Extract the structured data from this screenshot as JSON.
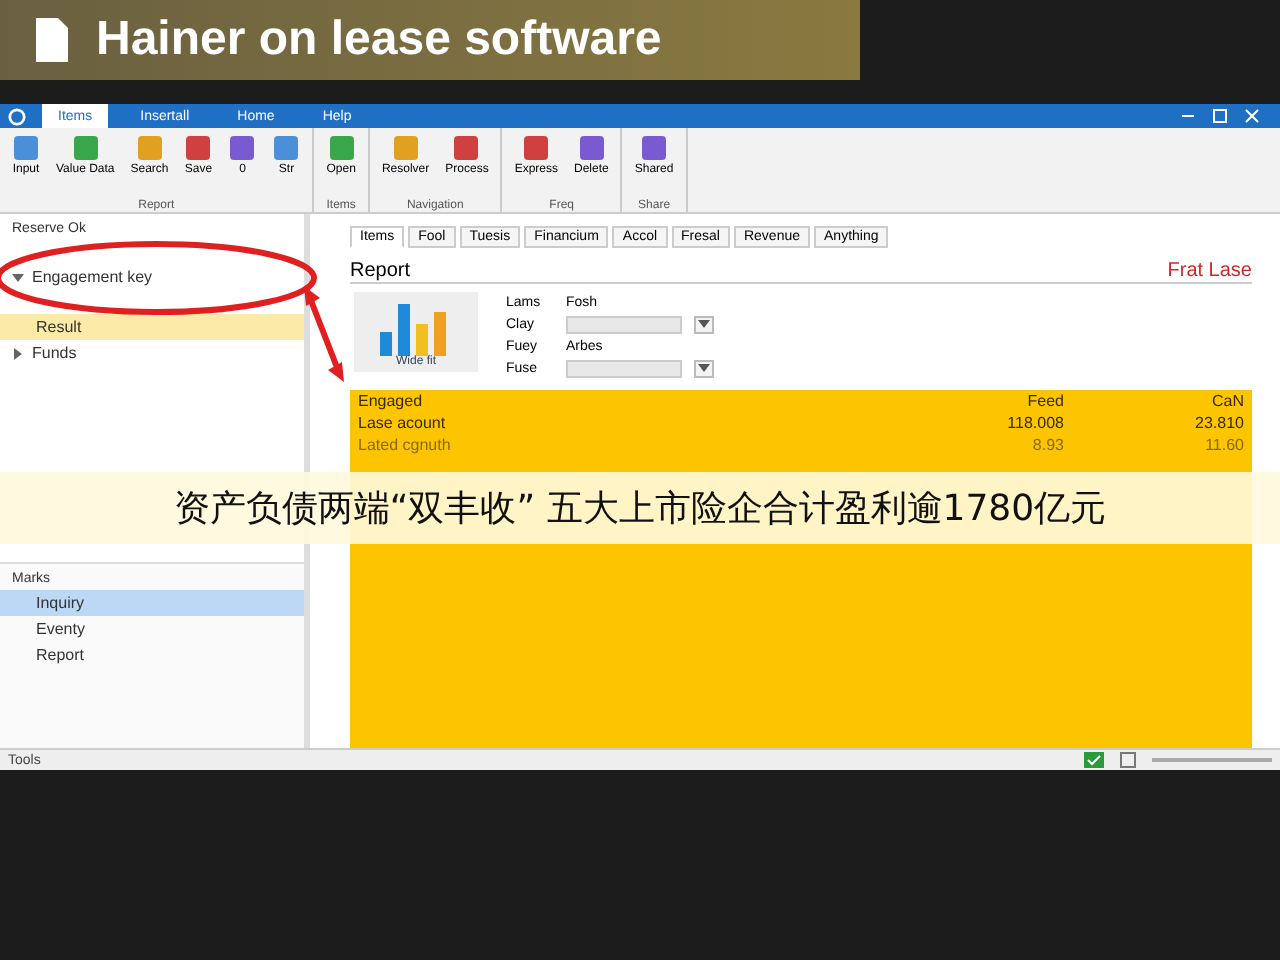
{
  "banner": {
    "title": "Hainer on lease software"
  },
  "window": {
    "tabs": [
      {
        "label": "Items",
        "selected": true
      },
      {
        "label": "Insertall",
        "selected": false
      },
      {
        "label": "Home",
        "selected": false
      },
      {
        "label": "Help",
        "selected": false
      }
    ]
  },
  "ribbon": {
    "groups": [
      {
        "label": "Report",
        "buttons": [
          "Input",
          "Value Data",
          "Search",
          "Save",
          "0",
          "Str"
        ]
      },
      {
        "label": "Items",
        "buttons": [
          "Open"
        ]
      },
      {
        "label": "Navigation",
        "buttons": [
          "Resolver",
          "Process"
        ]
      },
      {
        "label": "Freq",
        "buttons": [
          "Express",
          "Delete"
        ]
      },
      {
        "label": "Share",
        "buttons": [
          "Shared"
        ]
      }
    ]
  },
  "sidebar": {
    "header": "Reserve Ok",
    "tree": [
      {
        "label": "Engagement key",
        "expanded": true,
        "selected": false,
        "children": [
          {
            "label": "Result",
            "selected": true
          }
        ]
      },
      {
        "label": "Funds",
        "expanded": false,
        "selected": false
      }
    ],
    "lower_header": "Marks",
    "items": [
      {
        "label": "Inquiry",
        "selected": true
      },
      {
        "label": "Eventy",
        "selected": false
      },
      {
        "label": "Report",
        "selected": false
      }
    ]
  },
  "content": {
    "tabs": [
      {
        "label": "Items",
        "selected": true
      },
      {
        "label": "Fool",
        "selected": false
      },
      {
        "label": "Tuesis",
        "selected": false
      },
      {
        "label": "Financium",
        "selected": false
      },
      {
        "label": "Accol",
        "selected": false
      },
      {
        "label": "Fresal",
        "selected": false
      },
      {
        "label": "Revenue",
        "selected": false
      },
      {
        "label": "Anything",
        "selected": false
      }
    ],
    "section_title": "Report",
    "section_tag": "Frat Lase",
    "tile_label": "Wide fit",
    "fields": [
      {
        "label": "Lams",
        "kind": "text",
        "value": "Fosh"
      },
      {
        "label": "Clay",
        "kind": "select"
      },
      {
        "label": "Fuey",
        "kind": "text",
        "value": "Arbes"
      },
      {
        "label": "Fuse",
        "kind": "select"
      }
    ],
    "table": {
      "columns": [
        "Engaged",
        "Feed",
        "CaN"
      ],
      "rows": [
        [
          "Lase acount",
          "118.008",
          "23.810"
        ],
        [
          "Lated cgnuth",
          "8.93",
          "11.60"
        ]
      ]
    }
  },
  "caption": "资产负债两端“双丰收” 五大上市险企合计盈利逾1780亿元",
  "status_bar": {
    "text": "Tools"
  }
}
